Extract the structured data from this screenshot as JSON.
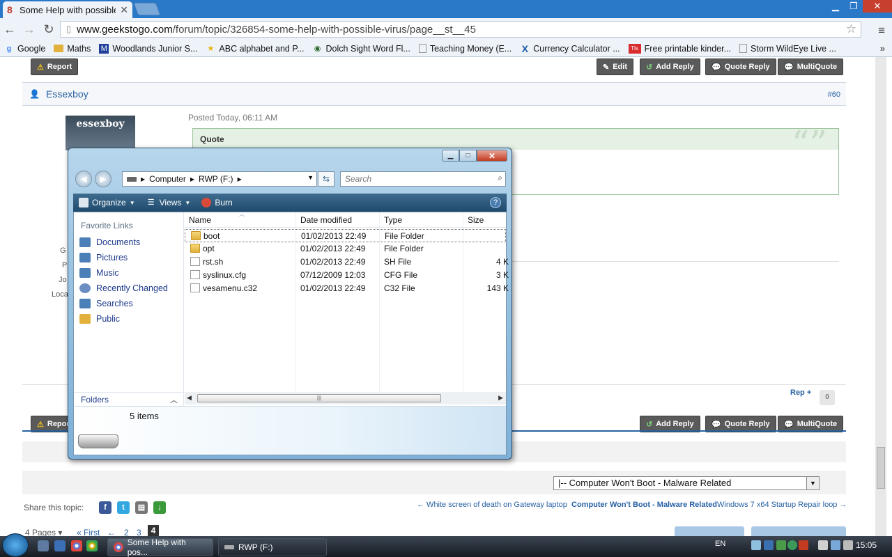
{
  "browser": {
    "tab_title": "Some Help with possible \\",
    "url_domain": "www.geekstogo.com",
    "url_path": "/forum/topic/326854-some-help-with-possible-virus/page__st__45"
  },
  "bookmarks": [
    {
      "label": "Google",
      "icon": "google-icon",
      "color": "#4285f4"
    },
    {
      "label": "Maths",
      "icon": "folder-icon",
      "color": "#e2b13c"
    },
    {
      "label": "Woodlands Junior S...",
      "icon": "school-icon",
      "color": "#1f3f9a"
    },
    {
      "label": "ABC alphabet and P...",
      "icon": "star-icon",
      "color": "#e8b300"
    },
    {
      "label": "Dolch Sight Word Fl...",
      "icon": "site-icon",
      "color": "#2a6a2a"
    },
    {
      "label": "Teaching Money (E...",
      "icon": "page-icon",
      "color": "#999999"
    },
    {
      "label": "Currency Calculator ...",
      "icon": "x-icon",
      "color": "#1f5ea8"
    },
    {
      "label": "Free printable kinder...",
      "icon": "tls-icon",
      "color": "#d92c2c"
    },
    {
      "label": "Storm WildEye Live ...",
      "icon": "page-icon",
      "color": "#999999"
    }
  ],
  "forum": {
    "report": "Report",
    "edit": "Edit",
    "add_reply": "Add Reply",
    "quote_reply": "Quote Reply",
    "multiquote": "MultiQuote",
    "username": "Essexboy",
    "post_number": "#60",
    "avatar_text": "essexboy",
    "posted": "Posted Today, 06:11 AM",
    "quote_label": "Quote",
    "rep_label": "Rep +",
    "rep_count": "0",
    "jump_select": "|-- Computer Won't Boot - Malware Related",
    "share_label": "Share this topic:",
    "prev_topic": "← White screen of death on Gateway laptop",
    "current_topic": "Computer Won't Boot - Malware Related",
    "next_topic": "Windows 7 x64 Startup Repair loop →",
    "pages_label": "4 Pages ▾",
    "first_label": "« First",
    "prev_arrow": "←",
    "page2": "2",
    "page3": "3",
    "page4": "4",
    "sidebar_frag": [
      "G",
      "P",
      "Jo",
      "Loca"
    ]
  },
  "explorer": {
    "breadcrumb": [
      "Computer",
      "RWP (F:)"
    ],
    "search_placeholder": "Search",
    "commands": {
      "organize": "Organize",
      "views": "Views",
      "burn": "Burn"
    },
    "favorite_links_header": "Favorite Links",
    "favorite_links": [
      {
        "label": "Documents",
        "color": "#4b7fb8"
      },
      {
        "label": "Pictures",
        "color": "#4b7fb8"
      },
      {
        "label": "Music",
        "color": "#4b7fb8"
      },
      {
        "label": "Recently Changed",
        "color": "#6a8ec2"
      },
      {
        "label": "Searches",
        "color": "#4b7fb8"
      },
      {
        "label": "Public",
        "color": "#e2b13c"
      }
    ],
    "folders_label": "Folders",
    "columns": {
      "name": "Name",
      "date": "Date modified",
      "type": "Type",
      "size": "Size"
    },
    "files": [
      {
        "name": "boot",
        "date": "01/02/2013 22:49",
        "type": "File Folder",
        "size": "",
        "kind": "folder"
      },
      {
        "name": "opt",
        "date": "01/02/2013 22:49",
        "type": "File Folder",
        "size": "",
        "kind": "folder"
      },
      {
        "name": "rst.sh",
        "date": "01/02/2013 22:49",
        "type": "SH File",
        "size": "4 K",
        "kind": "file"
      },
      {
        "name": "syslinux.cfg",
        "date": "07/12/2009 12:03",
        "type": "CFG File",
        "size": "3 K",
        "kind": "file"
      },
      {
        "name": "vesamenu.c32",
        "date": "01/02/2013 22:49",
        "type": "C32 File",
        "size": "143 K",
        "kind": "file"
      }
    ],
    "item_count": "5 items"
  },
  "taskbar": {
    "task1": "Some Help with pos...",
    "task2": "RWP (F:)",
    "lang": "EN",
    "clock": "15:05"
  }
}
